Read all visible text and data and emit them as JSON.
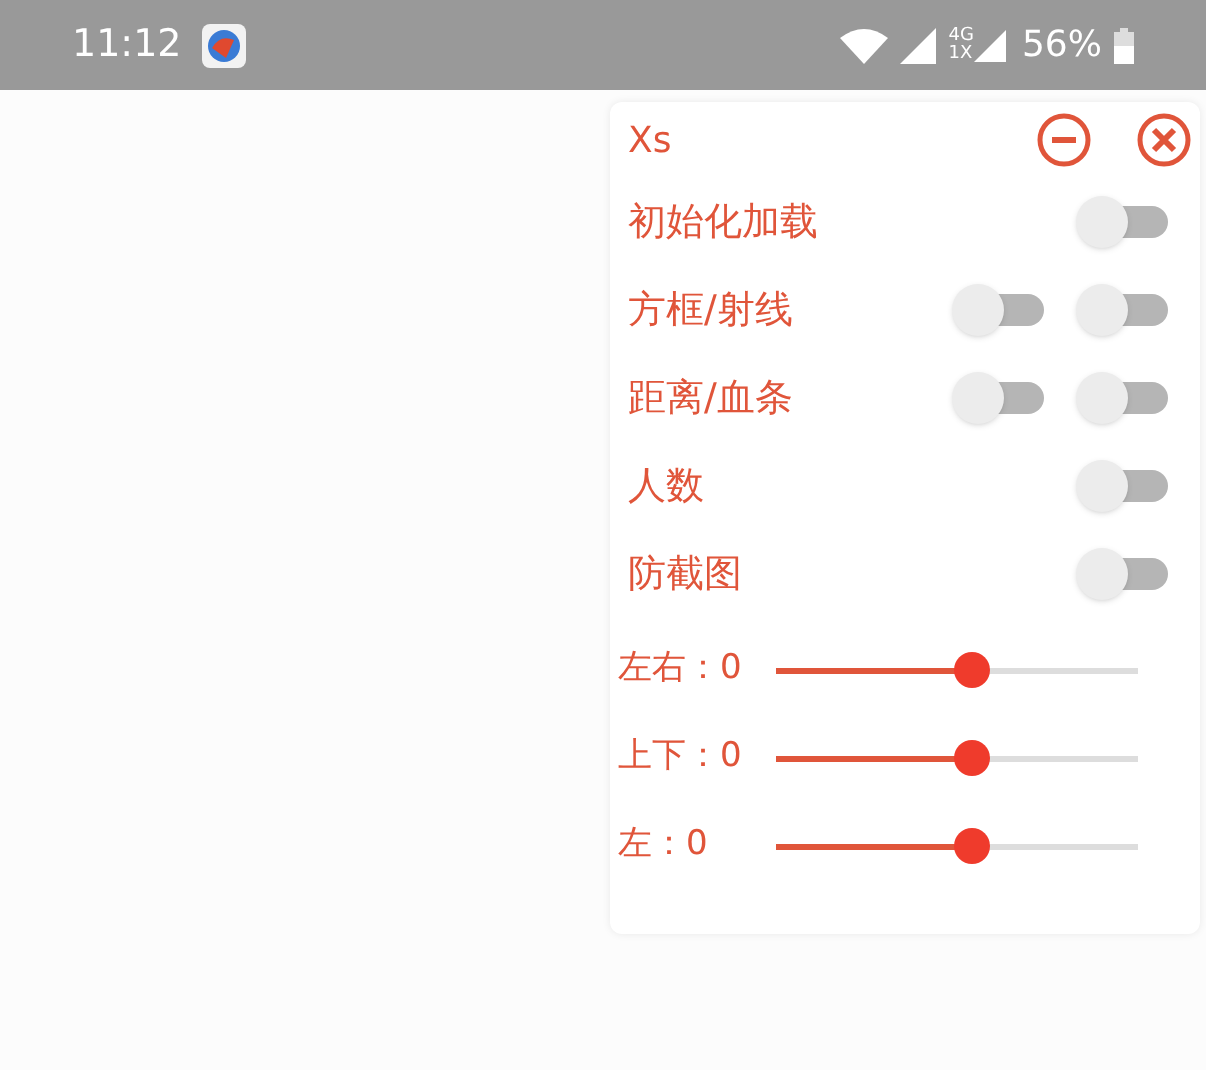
{
  "status_bar": {
    "time": "11:12",
    "network_top": "4G",
    "network_bottom": "1X",
    "battery": "56%"
  },
  "panel": {
    "title": "Xs",
    "toggles": [
      {
        "label": "初始化加载",
        "switches": [
          {
            "on": false
          }
        ]
      },
      {
        "label": "方框/射线",
        "switches": [
          {
            "on": false
          },
          {
            "on": false
          }
        ]
      },
      {
        "label": "距离/血条",
        "switches": [
          {
            "on": false
          },
          {
            "on": false
          }
        ]
      },
      {
        "label": "人数",
        "switches": [
          {
            "on": false
          }
        ]
      },
      {
        "label": "防截图",
        "switches": [
          {
            "on": false
          }
        ]
      }
    ],
    "sliders": [
      {
        "label": "左右：0",
        "level": 0.54
      },
      {
        "label": "上下：0",
        "level": 0.54
      },
      {
        "label": "左：0",
        "level": 0.54
      }
    ]
  }
}
